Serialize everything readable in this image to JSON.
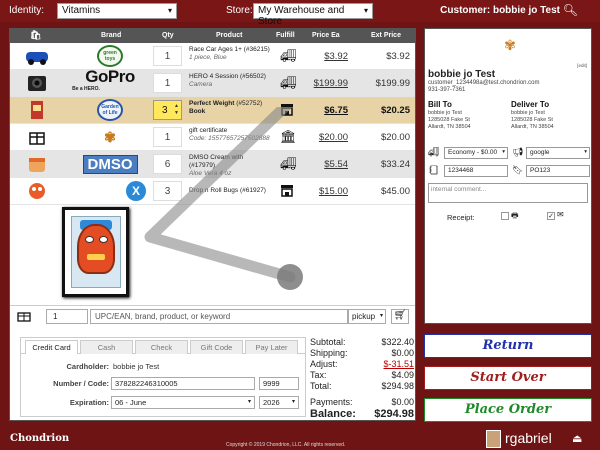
{
  "topbar": {
    "identity_label": "Identity:",
    "identity_value": "Vitamins",
    "store_label": "Store:",
    "store_value": "My Warehouse and Store",
    "customer": "Customer: bobbie jo Test",
    "search_icon": "search-icon"
  },
  "table": {
    "headers": {
      "brand": "Brand",
      "qty": "Qty",
      "product": "Product",
      "fulfill": "Fulfill",
      "price_ea": "Price Ea",
      "ext_price": "Ext Price"
    },
    "rows": [
      {
        "brand": "green toys",
        "qty": "1",
        "name": "Race Car Ages 1+",
        "sku": "(#36215)",
        "sub": "1 piece, Blue",
        "fulfill_icon": "truck-icon",
        "price": "$3.92",
        "ext": "$3.92"
      },
      {
        "brand": "GoPro",
        "brand_sub": "Be a HERO.",
        "qty": "1",
        "name": "HERO 4 Session",
        "sku": "(#56502)",
        "sub": "Camera",
        "fulfill_icon": "truck-icon",
        "price": "$199.99",
        "ext": "$199.99"
      },
      {
        "brand": "Garden of Life",
        "qty": "3",
        "name": "Perfect Weight",
        "sku": "(#52752)",
        "sub": "Book",
        "fulfill_icon": "store-icon",
        "price": "$6.75",
        "ext": "$20.25"
      },
      {
        "brand": "",
        "qty": "1",
        "name": "gift certificate",
        "sku": "",
        "sub": "Code: 15577657257502888",
        "fulfill_icon": "bank-icon",
        "price": "$20.00",
        "ext": "$20.00"
      },
      {
        "brand": "DMSO",
        "qty": "6",
        "name": "DMSO Cream with",
        "sku": "(#17979)",
        "sub": "Aloe Vera 4 oz",
        "fulfill_icon": "truck-icon",
        "price": "$5.54",
        "ext": "$33.24"
      },
      {
        "brand": "X",
        "qty": "3",
        "name": "Drop n Roll Bugs",
        "sku": "(#61927)",
        "sub": "",
        "fulfill_icon": "store-icon",
        "price": "$15.00",
        "ext": "$45.00"
      }
    ]
  },
  "addline": {
    "qty": "1",
    "search_placeholder": "UPC/EAN, brand, product, or keyword",
    "fulfill": "pickup"
  },
  "payment": {
    "tabs": [
      "Credit Card",
      "Cash",
      "Check",
      "Gift Code",
      "Pay Later"
    ],
    "cardholder_label": "Cardholder:",
    "cardholder": "bobbie jo Test",
    "number_label": "Number / Code:",
    "number": "378282246310005",
    "code": "9999",
    "expiration_label": "Expiration:",
    "exp_month": "06 - June",
    "exp_year": "2026"
  },
  "totals": {
    "subtotal_label": "Subtotal:",
    "subtotal": "$322.40",
    "shipping_label": "Shipping:",
    "shipping": "$0.00",
    "adjust_label": "Adjust:",
    "adjust": "$-31.51",
    "tax_label": "Tax:",
    "tax": "$4.09",
    "total_label": "Total:",
    "total": "$294.98",
    "payments_label": "Payments:",
    "payments": "$0.00",
    "balance_label": "Balance:",
    "balance": "$294.98"
  },
  "customer": {
    "edit": "[edit]",
    "name": "bobbie jo Test",
    "email": "customer_1234498a@test.chondrion.com",
    "phone": "931-397-7361",
    "bill_to_label": "Bill To",
    "bill_to": [
      "bobbie jo Test",
      "1285028 Fake St",
      "Allardt, TN 38504"
    ],
    "deliver_to_label": "Deliver To",
    "deliver_to": [
      "bobbie jo Test",
      "1285028 Fake St",
      "Allardt, TN 38504"
    ],
    "shipping_method": "Economy - $0.00",
    "referral": "google",
    "phone_field": "1234468",
    "po": "PO123",
    "comment_placeholder": "internal comment...",
    "receipt_label": "Receipt:"
  },
  "actions": {
    "return": "Return",
    "start_over": "Start Over",
    "place_order": "Place Order"
  },
  "footer": {
    "brand": "Chondrion",
    "copyright": "Copyright © 2019 Chondrion, LLC. All rights reserved.",
    "user": "rgabriel"
  },
  "colors": {
    "topbar": "#7a1616",
    "highlight_row": "#e7d3a6",
    "return": "#2233aa",
    "start_over": "#a11c1c",
    "place_order": "#1f8a2a"
  }
}
